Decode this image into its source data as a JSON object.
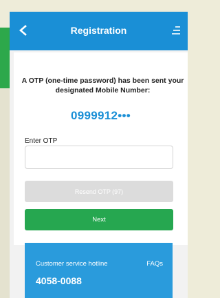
{
  "header": {
    "title": "Registration",
    "back_icon": "chevron-left-icon",
    "menu_icon": "menu-icon"
  },
  "otp": {
    "message": "A OTP (one-time password) has been sent your designated Mobile Number:",
    "phone_number": "0999912•••",
    "input_label": "Enter OTP",
    "input_value": "",
    "input_placeholder": ""
  },
  "buttons": {
    "resend_label": "Resend OTP (97)",
    "next_label": "Next"
  },
  "support": {
    "hotline_label": "Customer service hotline",
    "faqs_label": "FAQs",
    "hotline_number": "4058-0088"
  },
  "colors": {
    "header": "#1a8fd6",
    "accent_blue": "#1a8fd6",
    "next_green": "#26a750",
    "resend_disabled": "#dcdcdc"
  }
}
